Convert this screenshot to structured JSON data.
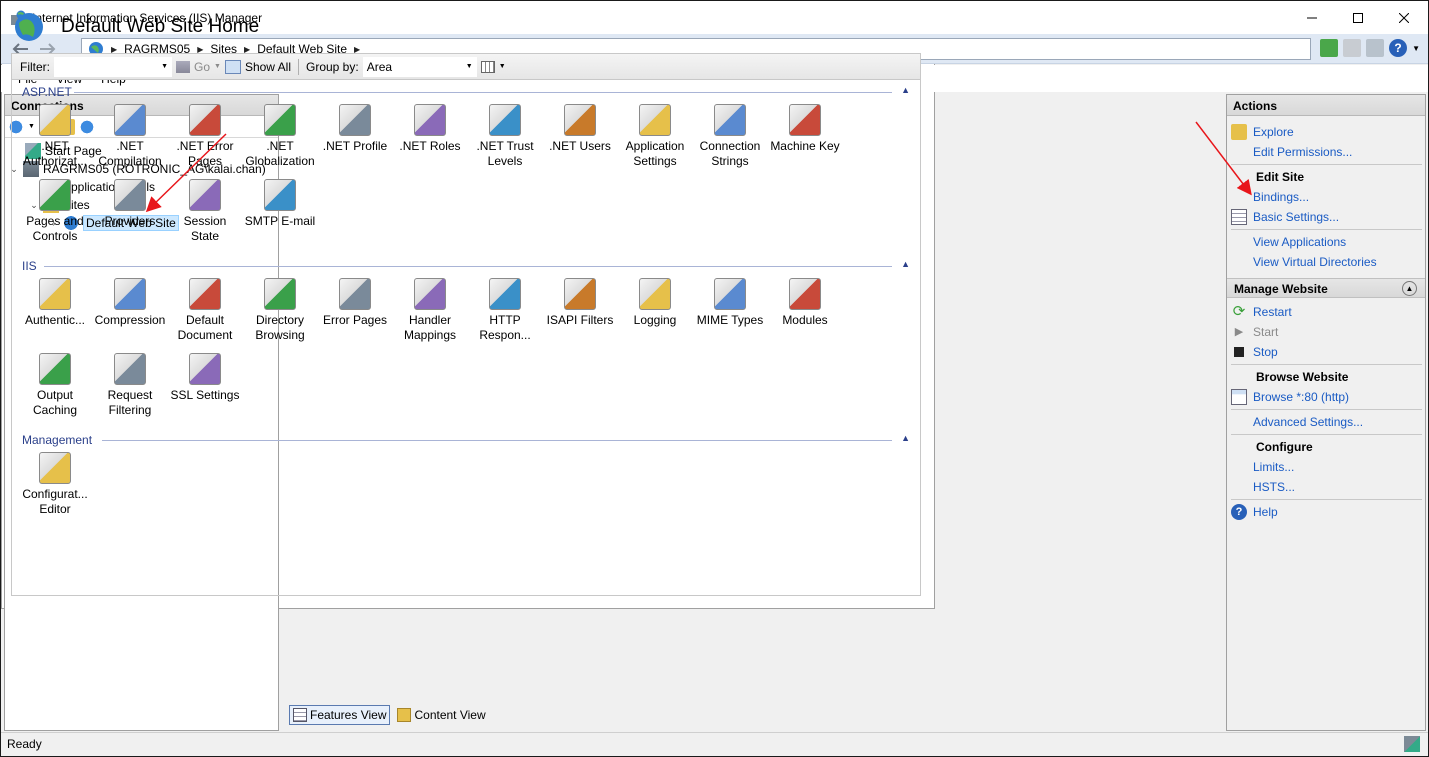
{
  "window": {
    "title": "Internet Information Services (IIS) Manager"
  },
  "address": {
    "crumbs": [
      "RAGRMS05",
      "Sites",
      "Default Web Site"
    ]
  },
  "menu": [
    "File",
    "View",
    "Help"
  ],
  "connections": {
    "header": "Connections",
    "tree": [
      {
        "label": "Start Page",
        "icon": "start-page-icon"
      },
      {
        "label": "RAGRMS05 (ROTRONIC_AG\\kalai.chan)",
        "icon": "server-icon"
      },
      {
        "label": "Application Pools",
        "icon": "app-pools-icon"
      },
      {
        "label": "Sites",
        "icon": "sites-folder-icon"
      },
      {
        "label": "Default Web Site",
        "icon": "globe-icon",
        "selected": true
      }
    ]
  },
  "center": {
    "title": "Default Web Site Home",
    "filter": {
      "label": "Filter:",
      "value": "",
      "go_label": "Go",
      "show_all_label": "Show All",
      "group_by_label": "Group by:",
      "group_by_value": "Area"
    },
    "sections": [
      {
        "name": "ASP.NET",
        "features": [
          {
            "label": ".NET Authorizat...",
            "icon": "net-authorization-icon"
          },
          {
            "label": ".NET Compilation",
            "icon": "net-compilation-icon"
          },
          {
            "label": ".NET Error Pages",
            "icon": "net-error-pages-icon"
          },
          {
            "label": ".NET Globalization",
            "icon": "net-globalization-icon"
          },
          {
            "label": ".NET Profile",
            "icon": "net-profile-icon"
          },
          {
            "label": ".NET Roles",
            "icon": "net-roles-icon"
          },
          {
            "label": ".NET Trust Levels",
            "icon": "net-trust-levels-icon"
          },
          {
            "label": ".NET Users",
            "icon": "net-users-icon"
          },
          {
            "label": "Application Settings",
            "icon": "application-settings-icon"
          },
          {
            "label": "Connection Strings",
            "icon": "connection-strings-icon"
          },
          {
            "label": "Machine Key",
            "icon": "machine-key-icon"
          },
          {
            "label": "Pages and Controls",
            "icon": "pages-controls-icon"
          },
          {
            "label": "Providers",
            "icon": "providers-icon"
          },
          {
            "label": "Session State",
            "icon": "session-state-icon"
          },
          {
            "label": "SMTP E-mail",
            "icon": "smtp-email-icon"
          }
        ]
      },
      {
        "name": "IIS",
        "features": [
          {
            "label": "Authentic...",
            "icon": "authentication-icon"
          },
          {
            "label": "Compression",
            "icon": "compression-icon"
          },
          {
            "label": "Default Document",
            "icon": "default-document-icon"
          },
          {
            "label": "Directory Browsing",
            "icon": "directory-browsing-icon"
          },
          {
            "label": "Error Pages",
            "icon": "error-pages-icon"
          },
          {
            "label": "Handler Mappings",
            "icon": "handler-mappings-icon"
          },
          {
            "label": "HTTP Respon...",
            "icon": "http-response-icon"
          },
          {
            "label": "ISAPI Filters",
            "icon": "isapi-filters-icon"
          },
          {
            "label": "Logging",
            "icon": "logging-icon"
          },
          {
            "label": "MIME Types",
            "icon": "mime-types-icon"
          },
          {
            "label": "Modules",
            "icon": "modules-icon"
          },
          {
            "label": "Output Caching",
            "icon": "output-caching-icon"
          },
          {
            "label": "Request Filtering",
            "icon": "request-filtering-icon"
          },
          {
            "label": "SSL Settings",
            "icon": "ssl-settings-icon"
          }
        ]
      },
      {
        "name": "Management",
        "features": [
          {
            "label": "Configurat... Editor",
            "icon": "configuration-editor-icon"
          }
        ]
      }
    ],
    "tabs": [
      {
        "label": "Features View",
        "active": true
      },
      {
        "label": "Content View",
        "active": false
      }
    ]
  },
  "actions": {
    "header": "Actions",
    "explore": "Explore",
    "edit_permissions": "Edit Permissions...",
    "edit_site": "Edit Site",
    "bindings": "Bindings...",
    "basic_settings": "Basic Settings...",
    "view_applications": "View Applications",
    "view_virtual_directories": "View Virtual Directories",
    "manage_website": "Manage Website",
    "restart": "Restart",
    "start": "Start",
    "stop": "Stop",
    "browse_website": "Browse Website",
    "browse_80": "Browse *:80 (http)",
    "advanced_settings": "Advanced Settings...",
    "configure": "Configure",
    "limits": "Limits...",
    "hsts": "HSTS...",
    "help": "Help"
  },
  "status": {
    "text": "Ready"
  },
  "colors": {
    "link": "#1a5bc4",
    "section": "#2a3f8a",
    "annotation_arrow": "#e8161b"
  }
}
